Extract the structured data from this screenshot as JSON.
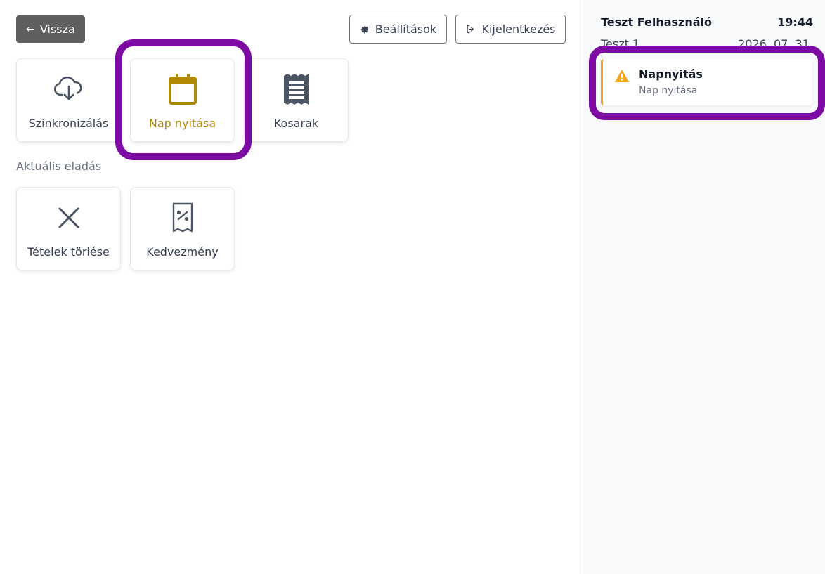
{
  "header": {
    "back_label": "Vissza",
    "settings_label": "Beállítások",
    "logout_label": "Kijelentkezés"
  },
  "tiles_top": [
    {
      "label": "Szinkronizálás",
      "icon": "cloud-download-icon"
    },
    {
      "label": "Nap nyitása",
      "icon": "calendar-icon",
      "active": true
    },
    {
      "label": "Kosarak",
      "icon": "receipt-icon"
    }
  ],
  "section": {
    "current_sale_label": "Aktuális eladás"
  },
  "tiles_sale": [
    {
      "label": "Tételek törlése",
      "icon": "close-icon"
    },
    {
      "label": "Kedvezmény",
      "icon": "discount-receipt-icon"
    }
  ],
  "sidebar": {
    "user_name": "Teszt Felhasználó",
    "time": "19:44",
    "register": "Teszt 1",
    "date": "2026. 07. 31.",
    "notice": {
      "title": "Napnyitás",
      "subtitle": "Nap nyitása",
      "icon": "warning-icon"
    }
  },
  "colors": {
    "active_accent": "#b08900",
    "highlight": "#7d0aa3",
    "warning": "#f4a41c",
    "back_button_bg": "#5f5f5f"
  }
}
